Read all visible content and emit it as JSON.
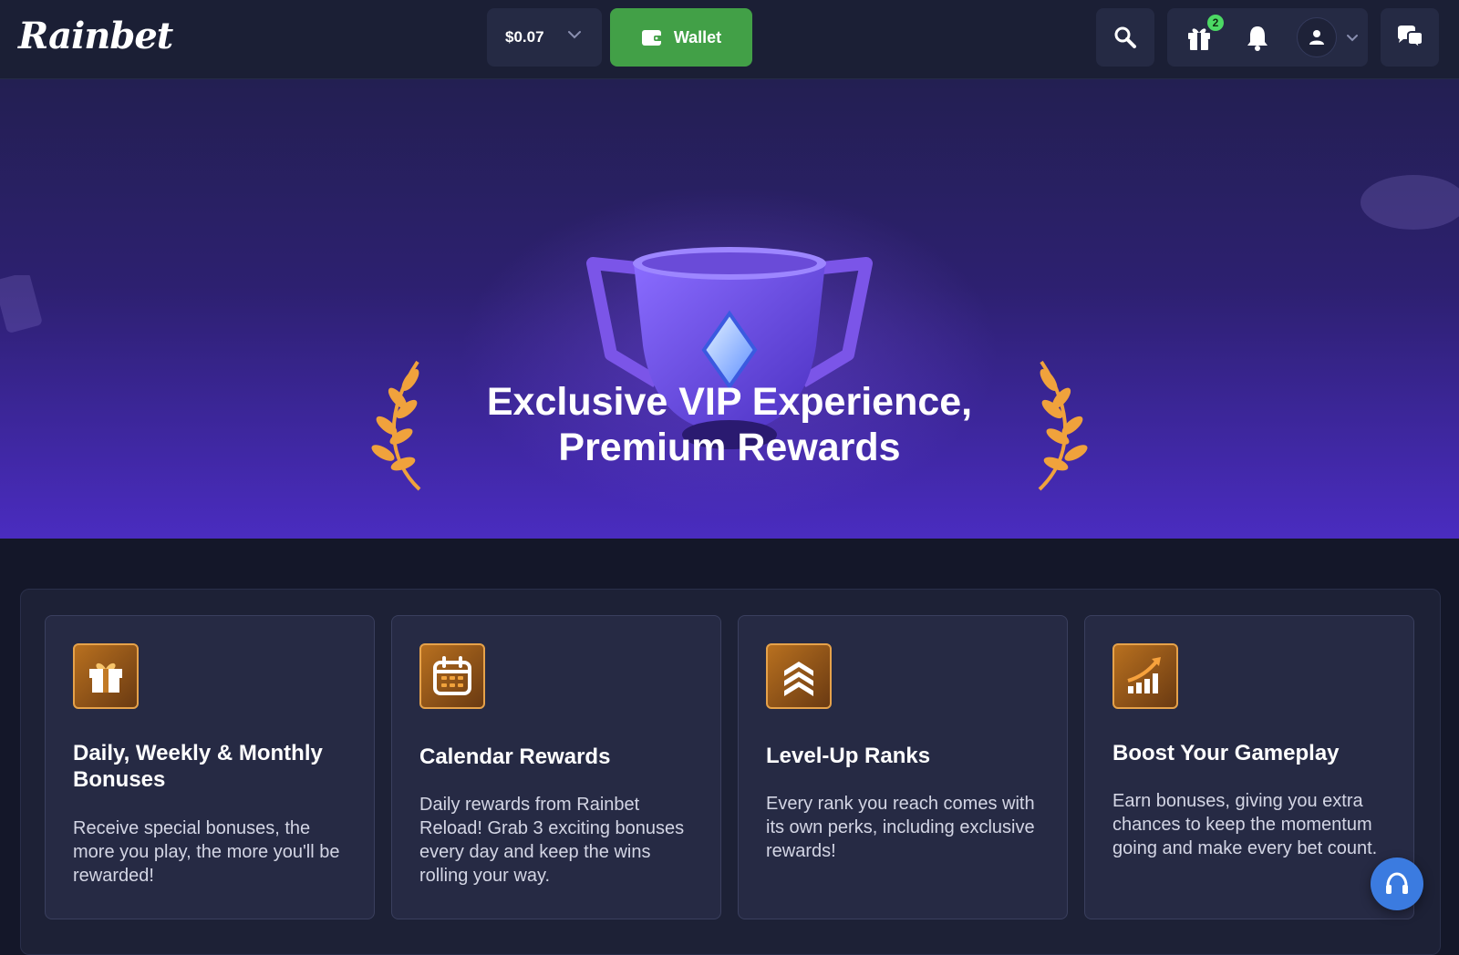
{
  "header": {
    "logo_text": "Rainbet",
    "balance": "$0.07",
    "wallet_label": "Wallet",
    "gift_badge_count": "2",
    "icons": [
      "search-icon",
      "gift-icon",
      "bell-icon",
      "user-icon",
      "chat-icon"
    ]
  },
  "hero": {
    "title_line1": "Exclusive VIP Experience,",
    "title_line2": "Premium Rewards"
  },
  "features": [
    {
      "icon": "gift-icon",
      "title": "Daily, Weekly & Monthly Bonuses",
      "description": "Receive special bonuses, the more you play, the more you'll be rewarded!"
    },
    {
      "icon": "calendar-icon",
      "title": "Calendar Rewards",
      "description": "Daily rewards from Rainbet Reload! Grab 3 exciting bonuses every day and keep the wins rolling your way."
    },
    {
      "icon": "rank-chevrons-icon",
      "title": "Level-Up Ranks",
      "description": "Every rank you reach comes with its own perks, including exclusive rewards!"
    },
    {
      "icon": "growth-chart-icon",
      "title": "Boost Your Gameplay",
      "description": "Earn bonuses, giving you extra chances to keep the momentum going and make every bet count."
    }
  ],
  "colors": {
    "wallet_green": "#42a047",
    "icon_gold": "#e6a24a",
    "hero_purple": "#4a2cc0",
    "support_blue": "#3b7be0",
    "badge_green": "#4cd964"
  }
}
